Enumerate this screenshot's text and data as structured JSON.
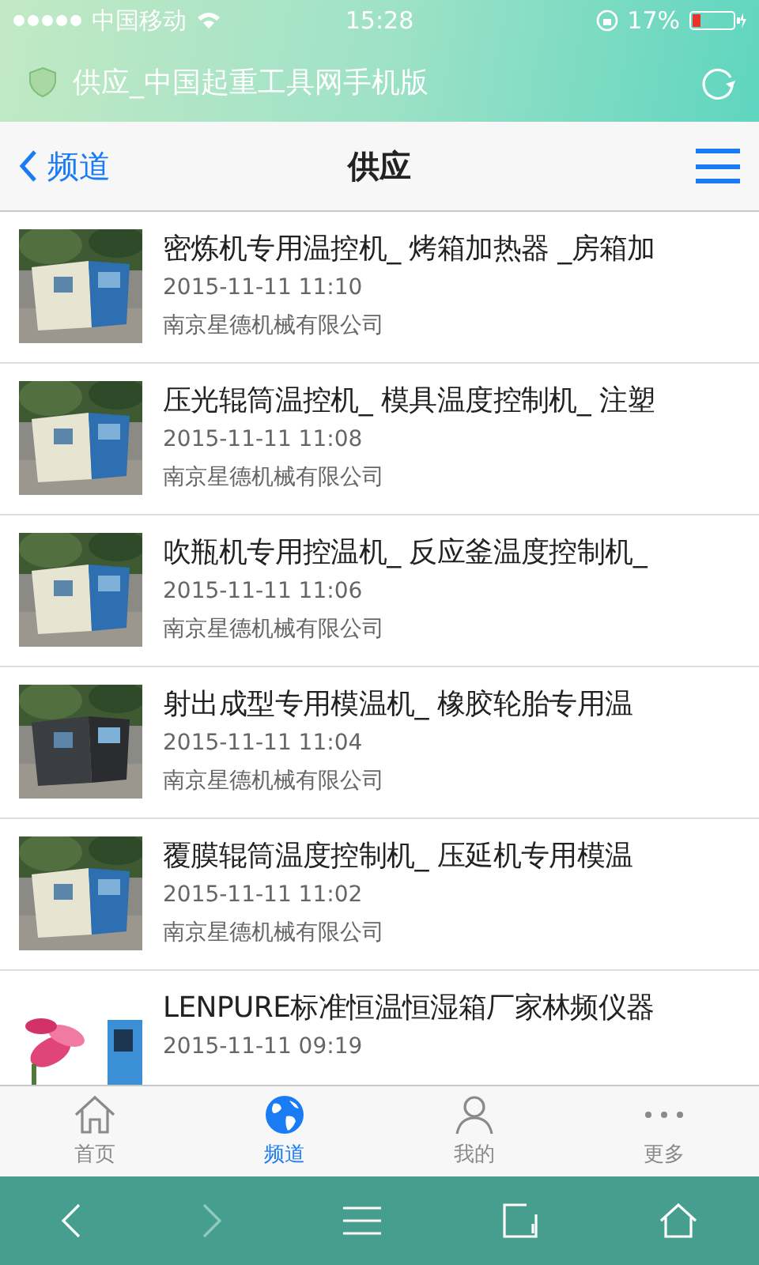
{
  "status_bar": {
    "carrier": "中国移动",
    "time": "15:28",
    "battery": "17%"
  },
  "browser_title": "供应_中国起重工具网手机版",
  "nav": {
    "back": "频道",
    "title": "供应"
  },
  "items": [
    {
      "kind": "machine",
      "title": "密炼机专用温控机_ 烤箱加热器 _房箱加",
      "date": "2015-11-11 11:10",
      "company": "南京星德机械有限公司"
    },
    {
      "kind": "machine",
      "title": "压光辊筒温控机_ 模具温度控制机_ 注塑",
      "date": "2015-11-11 11:08",
      "company": "南京星德机械有限公司"
    },
    {
      "kind": "machine",
      "title": "吹瓶机专用控温机_ 反应釜温度控制机_",
      "date": "2015-11-11 11:06",
      "company": "南京星德机械有限公司"
    },
    {
      "kind": "dark",
      "title": "射出成型专用模温机_ 橡胶轮胎专用温",
      "date": "2015-11-11 11:04",
      "company": "南京星德机械有限公司"
    },
    {
      "kind": "machine",
      "title": "覆膜辊筒温度控制机_ 压延机专用模温",
      "date": "2015-11-11 11:02",
      "company": "南京星德机械有限公司"
    },
    {
      "kind": "lotus",
      "title": "LENPURE标准恒温恒湿箱厂家林频仪器",
      "date": "2015-11-11 09:19"
    }
  ],
  "tabs": [
    {
      "kind": "home",
      "label": "首页",
      "selected": false
    },
    {
      "kind": "globe",
      "label": "频道",
      "selected": true
    },
    {
      "kind": "user",
      "label": "我的",
      "selected": false
    },
    {
      "kind": "more",
      "label": "更多",
      "selected": false
    }
  ]
}
